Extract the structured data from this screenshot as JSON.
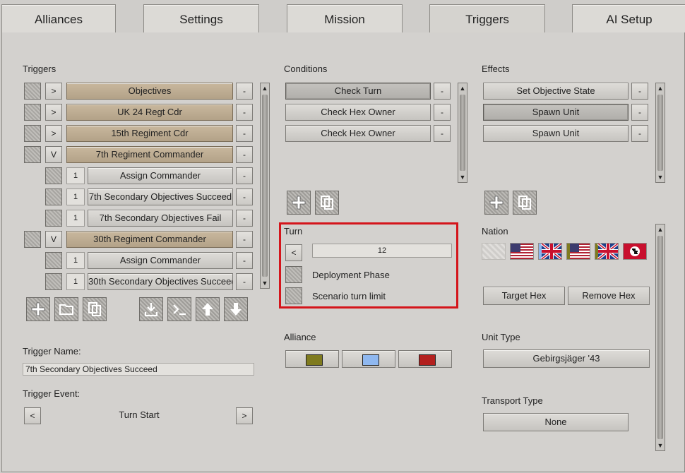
{
  "tabs": [
    {
      "label": "Alliances",
      "active": false
    },
    {
      "label": "Settings",
      "active": false
    },
    {
      "label": "Mission",
      "active": false
    },
    {
      "label": "Triggers",
      "active": true
    },
    {
      "label": "AI Setup",
      "active": false
    }
  ],
  "triggers": {
    "header": "Triggers",
    "items": [
      {
        "expand": ">",
        "label": "Objectives"
      },
      {
        "expand": ">",
        "label": "UK 24 Regt Cdr"
      },
      {
        "expand": ">",
        "label": "15th Regiment Cdr"
      },
      {
        "expand": "V",
        "label": "7th Regiment Commander"
      },
      {
        "num": "1",
        "label": "Assign Commander"
      },
      {
        "num": "1",
        "label": "7th Secondary Objectives Succeed"
      },
      {
        "num": "1",
        "label": "7th Secondary Objectives Fail"
      },
      {
        "expand": "V",
        "label": "30th Regiment Commander"
      },
      {
        "num": "1",
        "label": "Assign Commander"
      },
      {
        "num": "1",
        "label": "30th Secondary Objectives Succeed"
      }
    ],
    "remove_label": "-",
    "name_label": "Trigger Name:",
    "name_value": "7th Secondary Objectives Succeed",
    "event_label": "Trigger Event:",
    "event_value": "Turn Start",
    "prev": "<",
    "next": ">"
  },
  "conditions": {
    "header": "Conditions",
    "items": [
      "Check Turn",
      "Check Hex Owner",
      "Check Hex Owner"
    ],
    "remove_label": "-"
  },
  "effects": {
    "header": "Effects",
    "items": [
      "Set Objective State",
      "Spawn Unit",
      "Spawn Unit"
    ],
    "remove_label": "-"
  },
  "turn": {
    "header": "Turn",
    "prev": "<",
    "value": "12",
    "deployment_label": "Deployment Phase",
    "limit_label": "Scenario turn limit",
    "highlight_color": "#d4151b"
  },
  "alliance": {
    "header": "Alliance",
    "colors": [
      "#7f7b1f",
      "#8fb8f0",
      "#b3201e"
    ]
  },
  "nation": {
    "header": "Nation",
    "flags": [
      "blank-flag",
      "usa-flag",
      "uk-flag",
      "usa-flag",
      "italy-uk-flag",
      "germany-flag"
    ]
  },
  "target_hex_label": "Target Hex",
  "remove_hex_label": "Remove Hex",
  "unit_type": {
    "header": "Unit Type",
    "value": "Gebirgsjäger '43"
  },
  "transport_type": {
    "header": "Transport Type",
    "value": "None"
  }
}
